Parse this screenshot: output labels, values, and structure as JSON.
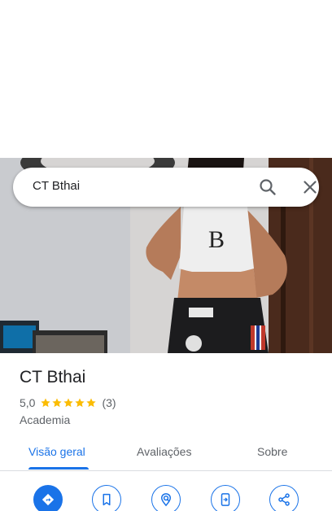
{
  "search": {
    "query": "CT Bthai"
  },
  "place": {
    "name": "CT Bthai",
    "rating": "5,0",
    "stars": 5,
    "review_count": "(3)",
    "category": "Academia"
  },
  "tabs": [
    {
      "label": "Visão geral",
      "active": true
    },
    {
      "label": "Avaliações",
      "active": false
    },
    {
      "label": "Sobre",
      "active": false
    }
  ],
  "actions": [
    {
      "icon": "directions-icon"
    },
    {
      "icon": "save-bookmark-icon"
    },
    {
      "icon": "nearby-icon"
    },
    {
      "icon": "send-to-phone-icon"
    },
    {
      "icon": "share-icon"
    }
  ],
  "colors": {
    "accent": "#1a73e8",
    "star": "#fbbc04",
    "text_primary": "#202124",
    "text_secondary": "#5f6368"
  }
}
